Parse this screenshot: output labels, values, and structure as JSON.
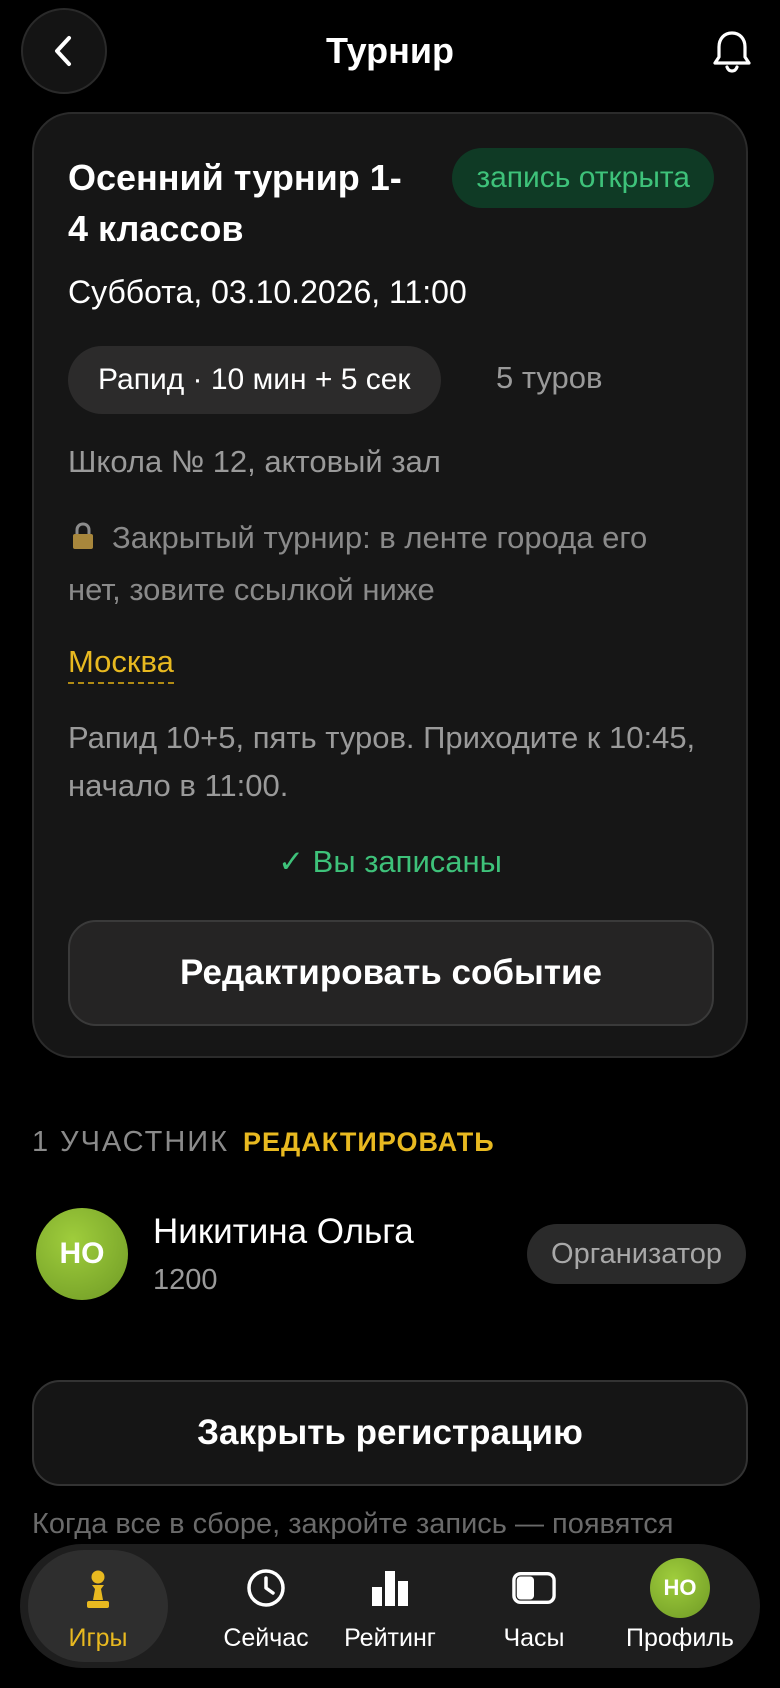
{
  "header": {
    "title": "Турнир"
  },
  "event": {
    "title": "Осенний турнир 1-4 классов",
    "status": "запись открыта",
    "date": "Суббота, 03.10.2026, 11:00",
    "format": "Рапид · 10 мин + 5 сек",
    "rounds": "5 туров",
    "place": "Школа № 12, актовый зал",
    "closed_note": "Закрытый турнир: в ленте города его нет, зовите ссылкой ниже",
    "city": "Москва",
    "description": "Рапид 10+5, пять туров. Приходите к 10:45, начало в 11:00.",
    "registered": "✓ Вы записаны",
    "edit_button": "Редактировать событие"
  },
  "participants": {
    "count_label": "1 УЧАСТНИК",
    "edit_label": "РЕДАКТИРОВАТЬ",
    "items": [
      {
        "initials": "НО",
        "name": "Никитина Ольга",
        "rating": "1200",
        "role": "Организатор"
      }
    ]
  },
  "actions": {
    "close_registration": "Закрыть регистрацию",
    "hint": "Когда все в сборе, закройте запись — появятся"
  },
  "tabbar": {
    "items": [
      {
        "label": "Игры",
        "icon": "pawn-icon",
        "active": true
      },
      {
        "label": "Сейчас",
        "icon": "clock-icon"
      },
      {
        "label": "Рейтинг",
        "icon": "bar-chart-icon"
      },
      {
        "label": "Часы",
        "icon": "chess-clock-icon"
      },
      {
        "label": "Профиль",
        "icon": "avatar",
        "initials": "НО"
      }
    ]
  },
  "colors": {
    "accent": "#e8b920",
    "success": "#3ec27a",
    "background": "#000000",
    "card": "#161616"
  }
}
